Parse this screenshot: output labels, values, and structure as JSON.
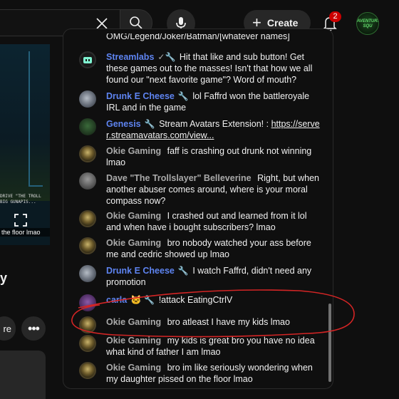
{
  "topbar": {
    "create_label": "Create",
    "notification_count": "2",
    "avatar_text": "AVENTURA SQU"
  },
  "video": {
    "overlay_text_1": "DRIVE \"THE TROLL",
    "overlay_text_2": "BIG GUNAPIS...",
    "caption": "the floor lmao"
  },
  "left": {
    "title_fragment": "y",
    "action_label": "re",
    "more_label": "•••"
  },
  "chat": {
    "messages": [
      {
        "author": "",
        "text": "OMG/Legend/Joker/Batman/[whatever names]",
        "avatar": "none"
      },
      {
        "author": "Streamlabs",
        "badges": "✓",
        "text": "Hit that like and sub button! Get these games out to the masses! Isn't that how we all found our \"next favorite game\"? Word of mouth?",
        "avatar": "streamlabs"
      },
      {
        "author": "Drunk E Cheese",
        "text": "lol Faffrd won the battleroyale IRL and in the game",
        "avatar": "drunk"
      },
      {
        "author": "Genesis",
        "text": "Stream Avatars Extension! : ",
        "link": "https://server.streamavatars.com/view...",
        "link_line1": "https://serve",
        "link_line2": "r.streamavatars.com/view...",
        "avatar": "genesis"
      },
      {
        "author": "Okie Gaming",
        "text": "faff is crashing out drunk not winning lmao",
        "avatar": "okie"
      },
      {
        "author": "Dave \"The Trollslayer\" Belleverine",
        "text": "Right, but when another abuser comes around, where is your moral compass now?",
        "avatar": "dave"
      },
      {
        "author": "Okie Gaming",
        "text": "I crashed out and learned from it lol and when have i bought subscribers? lmao",
        "avatar": "okie"
      },
      {
        "author": "Okie Gaming",
        "text": "bro nobody watched your ass before me and cedric showed up lmao",
        "avatar": "okie"
      },
      {
        "author": "Drunk E Cheese",
        "text": "I watch Faffrd, didn't need any promotion",
        "avatar": "drunk"
      },
      {
        "author": "carla",
        "badges": "🐱",
        "text": "!attack EatingCtrlV",
        "avatar": "carla"
      },
      {
        "author": "Okie Gaming",
        "text": "bro atleast I have my kids lmao",
        "avatar": "okie"
      },
      {
        "author": "Okie Gaming",
        "text": "my kids is great bro you have no idea what kind of father I am lmao",
        "avatar": "okie"
      },
      {
        "author": "Okie Gaming",
        "text": "bro im like seriously wondering when my daughter pissed on the floor lmao",
        "avatar": "okie"
      }
    ]
  },
  "colors": {
    "background": "#0f0f0f",
    "moderator_name": "#5e84f1",
    "annotation_red": "#d32525",
    "notification_badge": "#cc0000"
  },
  "icons": [
    "clear-icon",
    "search-icon",
    "mic-icon",
    "plus-icon",
    "bell-icon",
    "fullscreen-icon",
    "wrench-icon",
    "verified-check-icon"
  ]
}
